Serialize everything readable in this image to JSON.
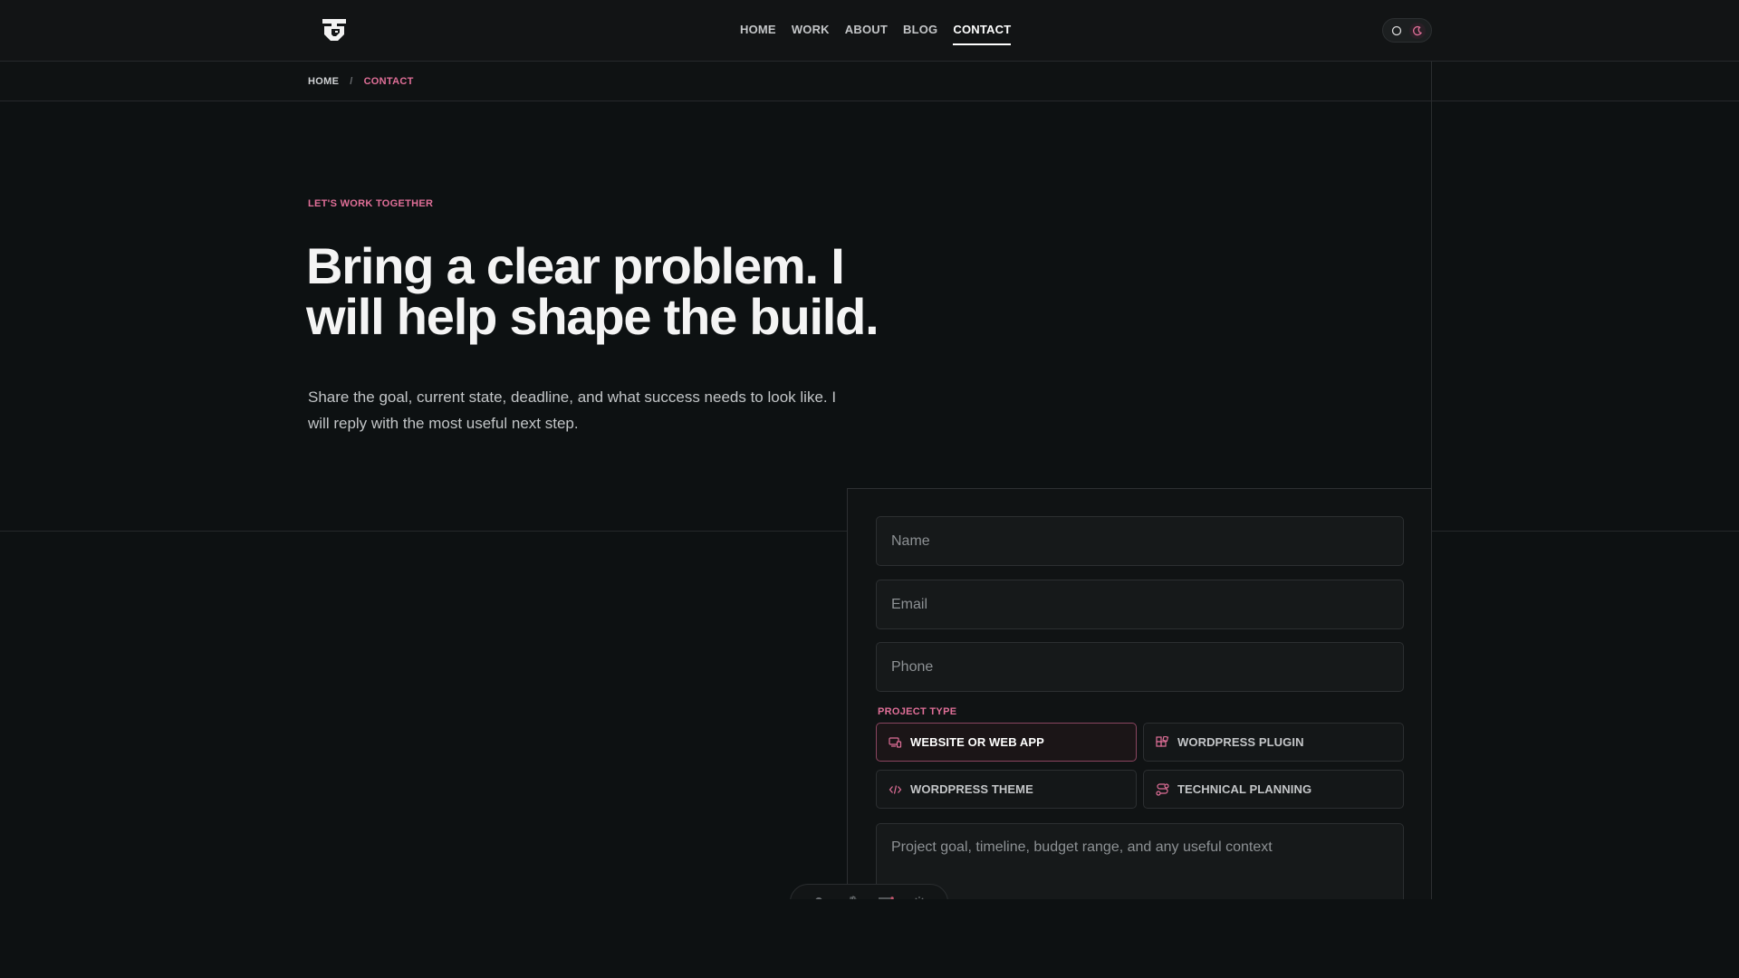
{
  "nav": {
    "items": [
      {
        "label": "HOME",
        "active": false
      },
      {
        "label": "WORK",
        "active": false
      },
      {
        "label": "ABOUT",
        "active": false
      },
      {
        "label": "BLOG",
        "active": false
      },
      {
        "label": "CONTACT",
        "active": true
      }
    ]
  },
  "theme_toggle": {
    "light_icon": "circle-icon",
    "dark_icon": "moon-icon",
    "selected": "dark"
  },
  "breadcrumb": {
    "home": "HOME",
    "separator": "/",
    "current": "CONTACT"
  },
  "hero": {
    "eyebrow": "LET'S WORK TOGETHER",
    "headline": "Bring a clear problem. I will help shape the build.",
    "lede": "Share the goal, current state, deadline, and what success needs to look like. I will reply with the most useful next step."
  },
  "form": {
    "name_placeholder": "Name",
    "email_placeholder": "Email",
    "phone_placeholder": "Phone",
    "project_type_label": "PROJECT TYPE",
    "options": [
      {
        "label": "WEBSITE OR WEB APP",
        "icon": "devices-icon",
        "selected": true
      },
      {
        "label": "WORDPRESS PLUGIN",
        "icon": "blocks-icon",
        "selected": false
      },
      {
        "label": "WORDPRESS THEME",
        "icon": "code-icon",
        "selected": false
      },
      {
        "label": "TECHNICAL PLANNING",
        "icon": "route-icon",
        "selected": false
      }
    ],
    "message_placeholder": "Project goal, timeline, budget range, and any useful context"
  },
  "dock": {
    "icons": [
      "bell-icon",
      "hand-icon",
      "menu-icon",
      "settings-icon"
    ]
  },
  "colors": {
    "accent": "#e06f98",
    "background": "#0d1112",
    "header": "#121415"
  }
}
